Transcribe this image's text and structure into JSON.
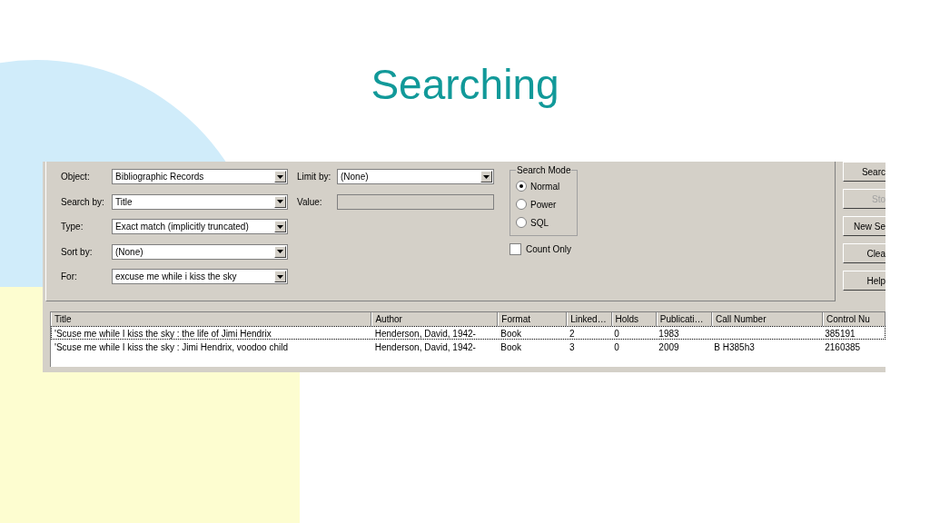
{
  "slide": {
    "title": "Searching"
  },
  "form": {
    "fields": [
      {
        "label": "Object:",
        "value": "Bibliographic Records"
      },
      {
        "label": "Search by:",
        "value": "Title"
      },
      {
        "label": "Type:",
        "value": "Exact match (implicitly truncated)"
      },
      {
        "label": "Sort by:",
        "value": "(None)"
      },
      {
        "label": "For:",
        "value": "excuse me while i kiss the sky"
      }
    ],
    "limit_by": {
      "label": "Limit by:",
      "value": "(None)"
    },
    "value_field": {
      "label": "Value:",
      "disabled": true
    },
    "search_mode": {
      "title": "Search Mode",
      "options": [
        {
          "label": "Normal",
          "selected": true
        },
        {
          "label": "Power",
          "selected": false
        },
        {
          "label": "SQL",
          "selected": false
        }
      ]
    },
    "count_only": {
      "label": "Count Only",
      "checked": false
    },
    "buttons": [
      {
        "label": "Searc",
        "disabled": false
      },
      {
        "label": "Sto",
        "disabled": true
      },
      {
        "label": "New Se",
        "disabled": false
      },
      {
        "label": "Clea",
        "disabled": false
      },
      {
        "label": "Help",
        "disabled": false
      }
    ]
  },
  "table": {
    "columns": [
      "Title",
      "Author",
      "Format",
      "Linked…",
      "Holds",
      "Publicati…",
      "Call Number",
      "Control Nu"
    ],
    "rows": [
      {
        "selected": true,
        "cells": [
          "'Scuse me while I kiss the sky : the life of Jimi Hendrix",
          "Henderson, David, 1942-",
          "Book",
          "2",
          "0",
          "1983",
          null,
          "385191"
        ]
      },
      {
        "selected": false,
        "cells": [
          "'Scuse me while I kiss the sky : Jimi Hendrix, voodoo child",
          "Henderson, David, 1942-",
          "Book",
          "3",
          "0",
          "2009",
          "B H385h3",
          "2160385"
        ]
      }
    ]
  }
}
